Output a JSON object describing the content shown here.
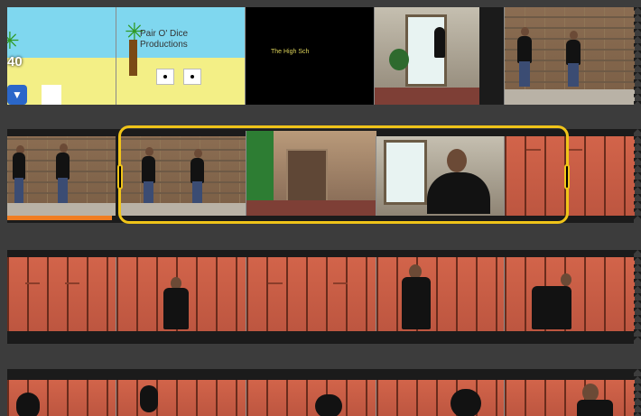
{
  "clip_browser": {
    "row1": {
      "partial_clip_badge": "40",
      "credits_clip_text": "Pair O' Dice\nProductions",
      "title_clip_text": "The High Sch"
    }
  },
  "colors": {
    "selection": "#f0c419",
    "used_bar": "#f07d22",
    "background": "#3c3c3c",
    "menu_button": "#2b67c9"
  },
  "icons": {
    "clip_menu": "chevron-down-icon"
  }
}
